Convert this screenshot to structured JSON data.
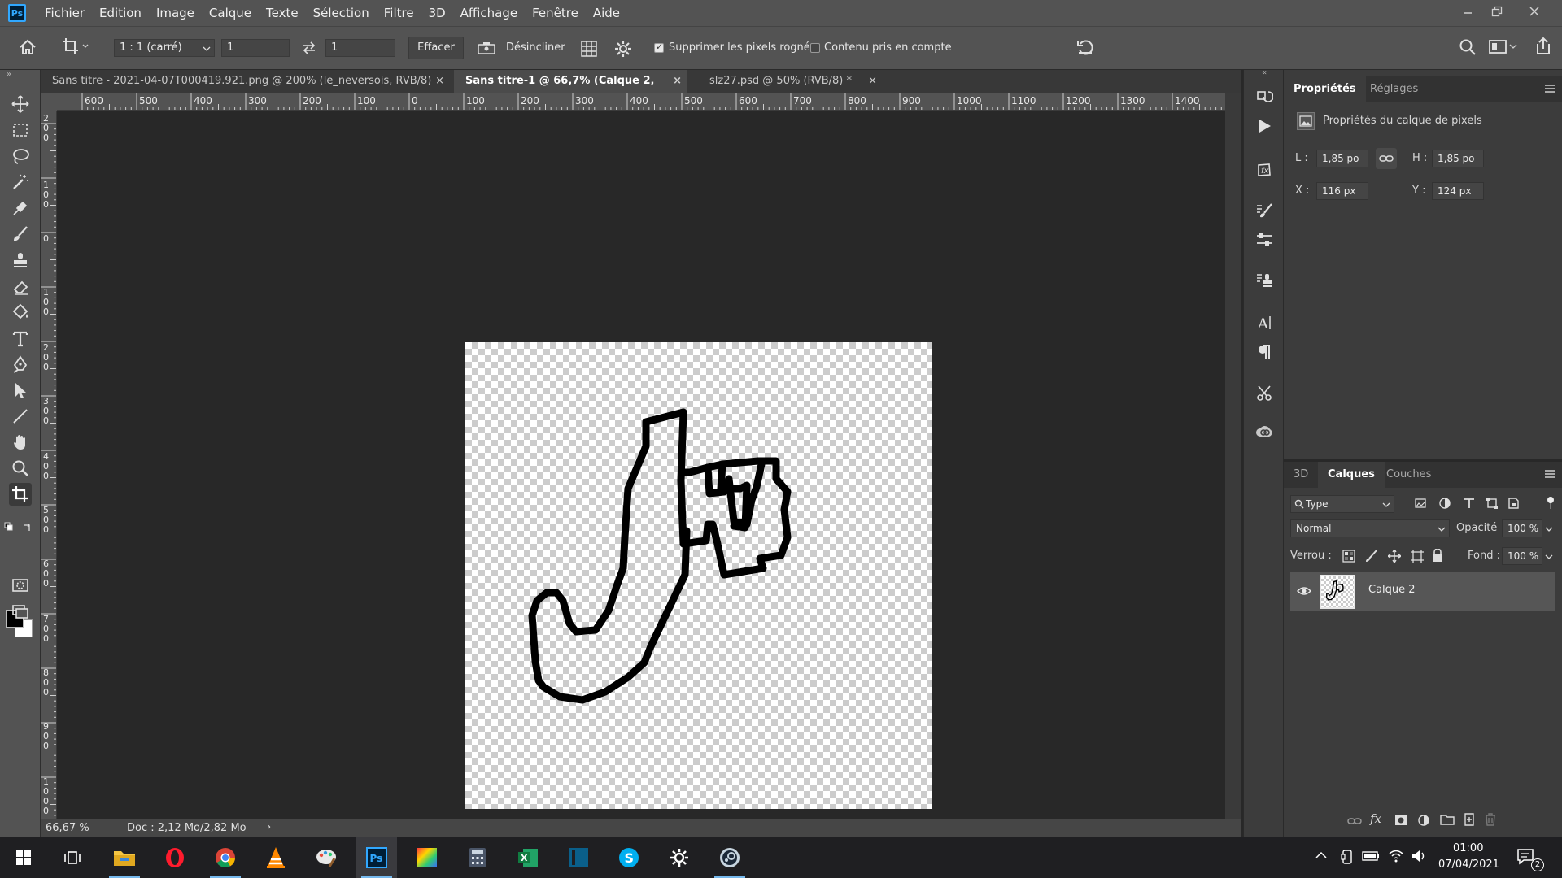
{
  "app": {
    "logo": "Ps",
    "menu": [
      "Fichier",
      "Edition",
      "Image",
      "Calque",
      "Texte",
      "Sélection",
      "Filtre",
      "3D",
      "Affichage",
      "Fenêtre",
      "Aide"
    ]
  },
  "options_bar": {
    "ratio": "1 : 1 (carré)",
    "width_value": "1",
    "height_value": "1",
    "clear_label": "Effacer",
    "straighten_label": "Désincliner",
    "delete_cropped_label": "Supprimer les pixels rognés",
    "delete_cropped_checked": true,
    "content_aware_label": "Contenu pris en compte",
    "content_aware_checked": false
  },
  "tabs": [
    {
      "label": "Sans titre - 2021-04-07T000419.921.png @ 200% (le_neversois, RVB/8)",
      "close": "×",
      "active": false
    },
    {
      "label": "Sans titre-1 @ 66,7% (Calque 2, RVB/8) *",
      "close": "×",
      "active": true
    },
    {
      "label": "slz27.psd @ 50% (RVB/8) *",
      "close": "×",
      "active": false
    }
  ],
  "ruler_h": [
    "600",
    "500",
    "400",
    "300",
    "200",
    "100",
    "0",
    "100",
    "200",
    "300",
    "400",
    "500",
    "600",
    "700",
    "800",
    "900",
    "1000",
    "1100",
    "1200",
    "1300",
    "1400"
  ],
  "ruler_v": [
    "200",
    "100",
    "0",
    "100",
    "200",
    "300",
    "400",
    "500",
    "600",
    "700",
    "800",
    "900",
    "1000"
  ],
  "status": {
    "zoom": "66,67 %",
    "doc": "Doc : 2,12 Mo/2,82 Mo",
    "arrow": "›"
  },
  "properties": {
    "tabs": [
      "Propriétés",
      "Réglages"
    ],
    "title": "Propriétés du calque de pixels",
    "w_label": "L :",
    "w_value": "1,85 po",
    "h_label": "H :",
    "h_value": "1,85 po",
    "x_label": "X :",
    "x_value": "116 px",
    "y_label": "Y :",
    "y_value": "124 px"
  },
  "layers": {
    "tabs": [
      "3D",
      "Calques",
      "Couches"
    ],
    "filter": "Type",
    "blend_mode": "Normal",
    "opacity_label": "Opacité :",
    "opacity_value": "100 %",
    "lock_label": "Verrou :",
    "fill_label": "Fond :",
    "fill_value": "100 %",
    "items": [
      {
        "name": "Calque 2",
        "visible": true
      }
    ]
  },
  "taskbar": {
    "apps": [
      "windows-start",
      "task-view",
      "file-explorer",
      "opera",
      "chrome",
      "vlc",
      "paint",
      "photoshop",
      "color-app",
      "calculator",
      "excel",
      "app-blue",
      "skype",
      "settings",
      "steam"
    ],
    "time": "01:00",
    "date": "07/04/2021",
    "notif_count": "2"
  },
  "colors": {
    "accent": "#31a8ff",
    "panel": "#3c3c3c",
    "bar": "#535353",
    "workspace": "#282828"
  }
}
